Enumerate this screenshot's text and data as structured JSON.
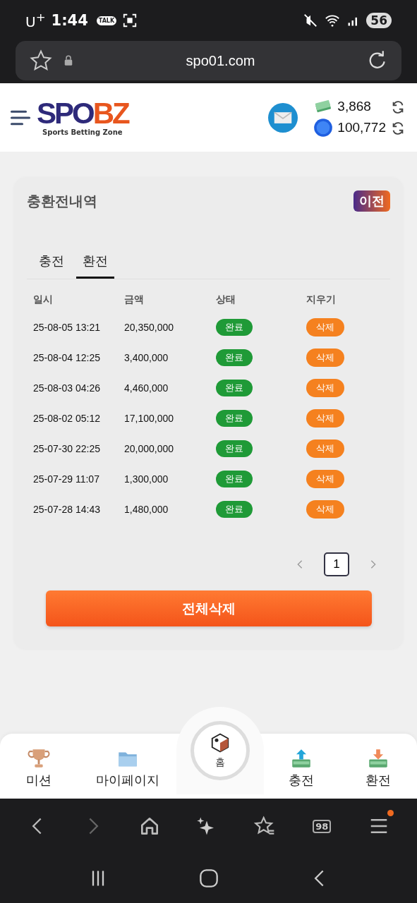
{
  "status_bar": {
    "carrier": "U$^{+}$",
    "time": "1:44",
    "chat_badge": "TALK",
    "battery": "56"
  },
  "browser": {
    "url": "spo01.com",
    "tab_count": "98",
    "menu_badge": true
  },
  "header": {
    "logo_left": "SPO",
    "logo_right": "BZ",
    "tagline": "Sports Betting Zone",
    "balance": "3,868",
    "points": "100,772"
  },
  "card": {
    "title": "충환전내역",
    "back_button": "이전",
    "tabs": [
      {
        "label": "충전",
        "selected": false
      },
      {
        "label": "환전",
        "selected": true
      }
    ],
    "columns": [
      "일시",
      "금액",
      "상태",
      "지우기"
    ],
    "rows": [
      {
        "date": "25-08-05 13:21",
        "amount": "20,350,000",
        "status": "완료",
        "action": "삭제"
      },
      {
        "date": "25-08-04 12:25",
        "amount": "3,400,000",
        "status": "완료",
        "action": "삭제"
      },
      {
        "date": "25-08-03 04:26",
        "amount": "4,460,000",
        "status": "완료",
        "action": "삭제"
      },
      {
        "date": "25-08-02 05:12",
        "amount": "17,100,000",
        "status": "완료",
        "action": "삭제"
      },
      {
        "date": "25-07-30 22:25",
        "amount": "20,000,000",
        "status": "완료",
        "action": "삭제"
      },
      {
        "date": "25-07-29 11:07",
        "amount": "1,300,000",
        "status": "완료",
        "action": "삭제"
      },
      {
        "date": "25-07-28 14:43",
        "amount": "1,480,000",
        "status": "완료",
        "action": "삭제"
      }
    ],
    "pages": [
      {
        "label": "1",
        "selected": true
      }
    ],
    "delete_all_button": "전체삭제"
  },
  "bottom_nav": [
    {
      "label": "미션",
      "kind": "trophy"
    },
    {
      "label": "마이페이지",
      "kind": "folder"
    },
    {
      "label": "홈",
      "kind": "home"
    },
    {
      "label": "충전",
      "kind": "deposit"
    },
    {
      "label": "환전",
      "kind": "withdraw"
    }
  ]
}
